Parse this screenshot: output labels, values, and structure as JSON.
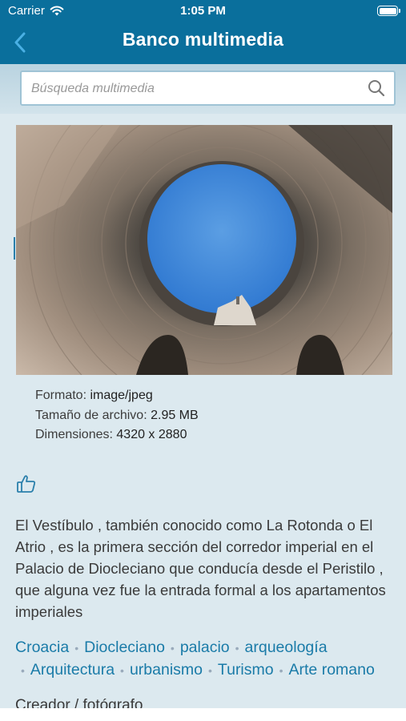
{
  "status_bar": {
    "carrier": "Carrier",
    "time": "1:05 PM"
  },
  "nav": {
    "title": "Banco multimedia"
  },
  "search": {
    "placeholder": "Búsqueda multimedia"
  },
  "meta": {
    "format_label": "Formato:",
    "format_value": "image/jpeg",
    "size_label": "Tamaño de archivo:",
    "size_value": "2.95 MB",
    "dims_label": "Dimensiones:",
    "dims_value": "4320 x 2880"
  },
  "description": "El Vestíbulo , también conocido como La Rotonda o El Atrio , es la primera sección del corredor imperial en el Palacio de Diocleciano que conducía desde el Peristilo , que alguna vez fue la entrada formal a los apartamentos imperiales",
  "tags": [
    "Croacia",
    "Diocleciano",
    "palacio",
    "arqueología",
    "Arquitectura",
    "urbanismo",
    "Turismo",
    "Arte romano"
  ],
  "creator_label": "Creador / fotógrafo",
  "colors": {
    "header": "#0a6f9c",
    "background": "#dce9ef",
    "link": "#1a7ba8"
  },
  "icons": {
    "back": "chevron-left-icon",
    "search": "search-icon",
    "like": "thumbs-up-icon",
    "wifi": "wifi-icon"
  }
}
